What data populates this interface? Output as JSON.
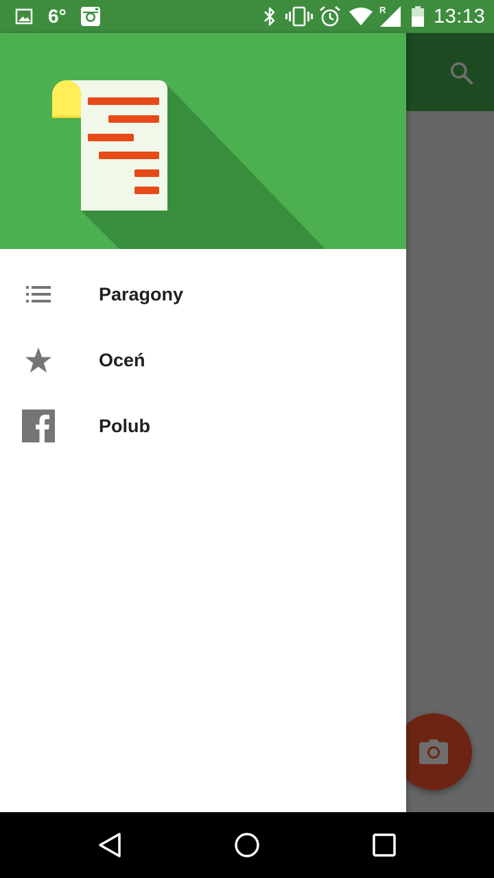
{
  "status_bar": {
    "temperature": "6°",
    "time": "13:13",
    "left_icons": [
      "image-icon",
      "instagram-icon"
    ],
    "right_icons": [
      "bluetooth-icon",
      "vibrate-icon",
      "alarm-icon",
      "wifi-icon",
      "signal-roaming-icon",
      "battery-icon"
    ],
    "roaming_indicator": "R"
  },
  "drawer": {
    "header_logo": "receipt-logo",
    "items": [
      {
        "label": "Paragony",
        "icon": "list-icon"
      },
      {
        "label": "Oceń",
        "icon": "star-icon"
      },
      {
        "label": "Polub",
        "icon": "facebook-icon"
      }
    ]
  },
  "app": {
    "toolbar_icon": "search-icon",
    "fab_icon": "camera-icon"
  },
  "nav_bar": {
    "buttons": [
      "back-icon",
      "home-icon",
      "recents-icon"
    ]
  },
  "colors": {
    "header_green": "#4caf50",
    "status_green": "#3e8d3f",
    "receipt_lines": "#e64a19",
    "fab_dimmed": "#6e2412"
  }
}
